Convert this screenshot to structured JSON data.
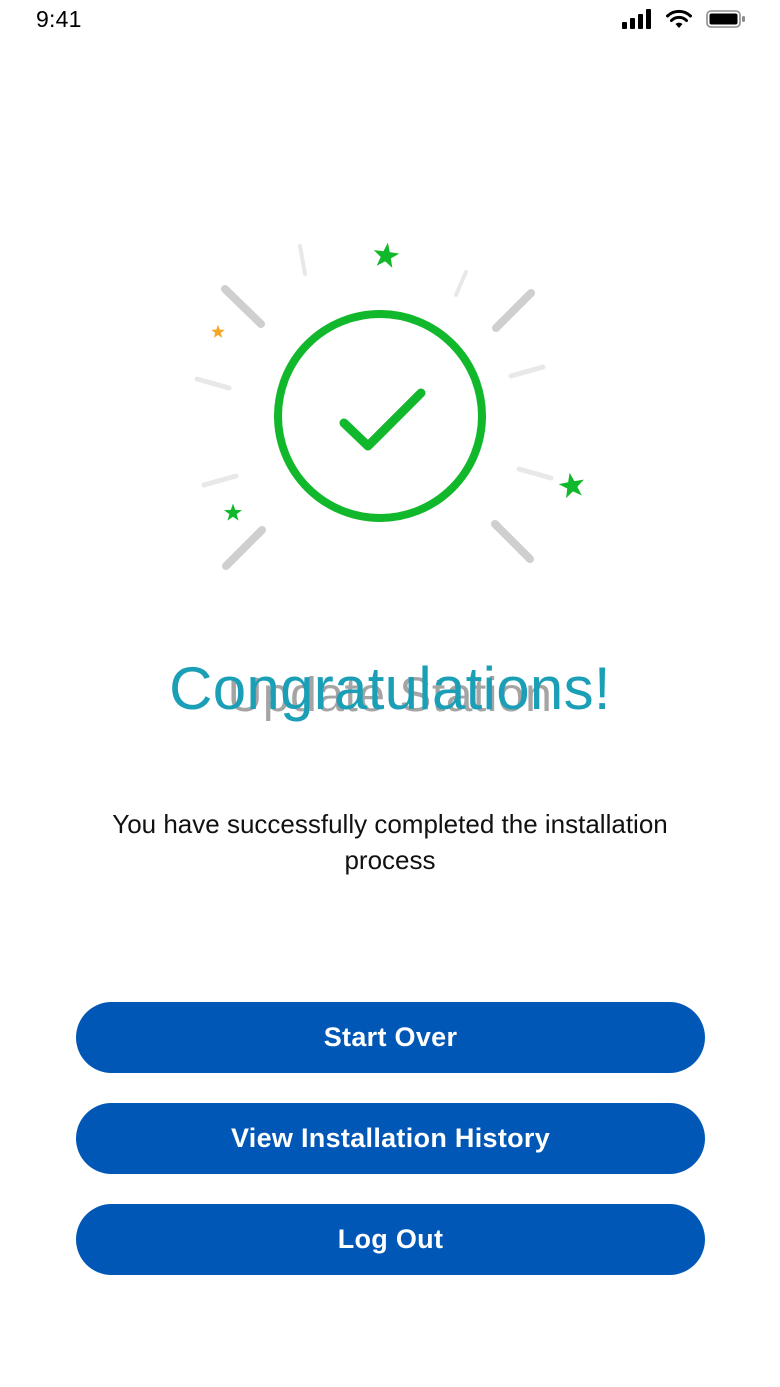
{
  "status_bar": {
    "time": "9:41",
    "icons": [
      "cellular-signal-icon",
      "wifi-icon",
      "battery-icon"
    ]
  },
  "illustration": {
    "icon": "success-checkmark-icon",
    "accent_color": "#12b82b",
    "star_colors": [
      "#12b82b",
      "#f5a623"
    ]
  },
  "heading": {
    "title": "Congratulations!",
    "ghost_title": "Update Station",
    "color": "#1a9fb6"
  },
  "message": {
    "text": "You have successfully completed the installation process"
  },
  "actions": {
    "start_over": "Start Over",
    "view_history": "View Installation History",
    "log_out": "Log Out",
    "button_color": "#0057b5"
  }
}
